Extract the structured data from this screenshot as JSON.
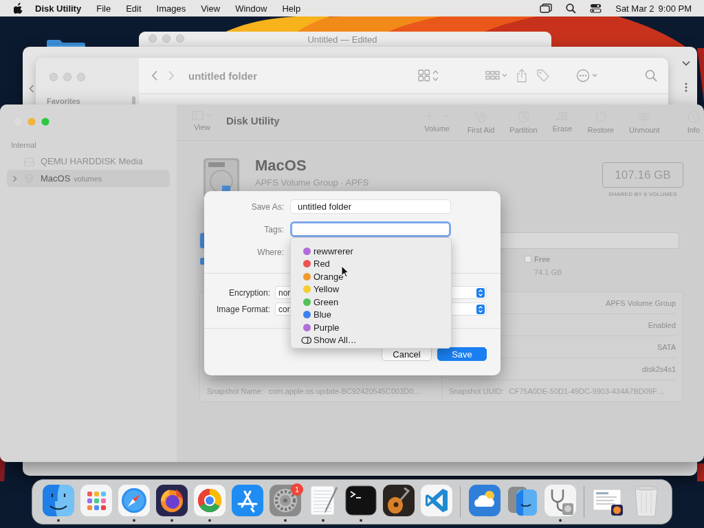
{
  "menu_bar": {
    "app_name": "Disk Utility",
    "menus": [
      "File",
      "Edit",
      "Images",
      "View",
      "Window",
      "Help"
    ],
    "date": "Sat Mar 2",
    "time": "9:00 PM"
  },
  "back_window": {
    "title": "Untitled — Edited"
  },
  "finder_window": {
    "title": "untitled folder",
    "sidebar_heading": "Favorites"
  },
  "disk_utility": {
    "title": "Disk Utility",
    "view_label": "View",
    "toolbar": [
      {
        "kind": "volume",
        "label": "Volume"
      },
      {
        "kind": "first_aid",
        "label": "First Aid"
      },
      {
        "kind": "partition",
        "label": "Partition"
      },
      {
        "kind": "erase",
        "label": "Erase"
      },
      {
        "kind": "restore",
        "label": "Restore"
      },
      {
        "kind": "unmount",
        "label": "Unmount"
      },
      {
        "kind": "info",
        "label": "Info"
      }
    ],
    "sidebar": {
      "section": "Internal",
      "items": [
        {
          "kind": "disk",
          "name": "QEMU HARDDISK Media",
          "selected": false
        },
        {
          "kind": "volume_group",
          "name": "MacOS",
          "detail": "volumes",
          "selected": true
        }
      ]
    },
    "volume": {
      "name": "MacOS",
      "subtitle": "APFS Volume Group · APFS",
      "capacity": "107.16 GB",
      "capacity_note": "SHARED BY 6 VOLUMES",
      "free_label": "Free",
      "free_value": "74.1 GB"
    },
    "info_rows": [
      {
        "right_value": "APFS Volume Group"
      },
      {
        "right_value": "Enabled"
      },
      {
        "right_value": "SATA"
      },
      {
        "right_value": "disk2s4s1"
      },
      {
        "left_label": "Snapshot Name:",
        "left_value": "com.apple.os.update-BC92420545C003D0…",
        "right_label": "Snapshot UUID:",
        "right_value": "CF75A0DE-50D1-49DC-9903-434A7BD09F…"
      }
    ]
  },
  "save_sheet": {
    "save_as_label": "Save As:",
    "save_as_value": "untitled folder",
    "tags_label": "Tags:",
    "tags_focused": true,
    "where_label": "Where:",
    "encryption_label": "Encryption:",
    "encryption_value": "nor",
    "format_label": "Image Format:",
    "format_value": "cor",
    "buttons": [
      {
        "label": "Cancel",
        "default": false
      },
      {
        "label": "Save",
        "default": true
      }
    ]
  },
  "tag_menu": {
    "items": [
      {
        "name": "rewwrerer",
        "color": "#b56cdb"
      },
      {
        "name": "Red",
        "color": "#ec5353"
      },
      {
        "name": "Orange",
        "color": "#f19a2c"
      },
      {
        "name": "Yellow",
        "color": "#f5cd31"
      },
      {
        "name": "Green",
        "color": "#52c15a"
      },
      {
        "name": "Blue",
        "color": "#3a82ef"
      },
      {
        "name": "Purple",
        "color": "#b06fd8"
      }
    ],
    "show_all": "Show All…"
  },
  "dock": {
    "sections": [
      {
        "items": [
          {
            "kind": "finder",
            "running": true
          },
          {
            "kind": "launchpad",
            "running": false
          },
          {
            "kind": "safari",
            "running": true
          },
          {
            "kind": "firefox",
            "running": true
          },
          {
            "kind": "chrome",
            "running": true
          },
          {
            "kind": "app_store",
            "running": false
          },
          {
            "kind": "settings",
            "running": true,
            "badge": "1"
          },
          {
            "kind": "textedit",
            "running": true
          },
          {
            "kind": "terminal",
            "running": true
          },
          {
            "kind": "garageband",
            "running": false
          },
          {
            "kind": "vscode",
            "running": false
          }
        ]
      },
      {
        "items": [
          {
            "kind": "weather",
            "running": false
          },
          {
            "kind": "migration",
            "running": false
          },
          {
            "kind": "disk_utility",
            "running": true
          }
        ]
      },
      {
        "items": [
          {
            "kind": "document",
            "running": false
          },
          {
            "kind": "trash",
            "running": false
          }
        ]
      }
    ]
  }
}
